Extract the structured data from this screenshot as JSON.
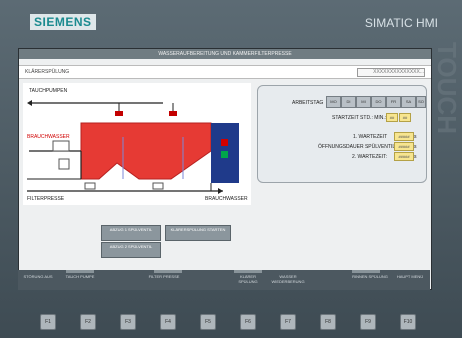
{
  "brand": "SIEMENS",
  "product": "SIMATIC HMI",
  "side_logo": "TOUCH",
  "screen": {
    "title": "WASSERAUFBEREITUNG UND KAMMERFILTERPRESSE",
    "left_status": "KLÄRERSPÜLUNG",
    "right_status": "XXXXXXXXXXXXXX..."
  },
  "diagram": {
    "tauchpumpen": "TAUCHPUMPEN",
    "brauchwasser_left": "BRAUCHWASSER",
    "filterpresse": "FILTERPRESSE",
    "brauchwasser_right": "BRAUCHWASSER"
  },
  "status_panel": {
    "arbeitstag": "ARBEITSTAG",
    "days": [
      "MO",
      "DI",
      "MI",
      "DO",
      "FR",
      "SA",
      "SO"
    ],
    "startzeit": "STARTZEIT STD.: MIN.:",
    "start_hour": "##",
    "start_min": "##",
    "wartezeit1_label": "1. WARTEZEIT",
    "wartezeit1_value": "#####",
    "oeffnungsdauer_label": "ÖFFNUNGSDAUER SPÜLVENTIL:",
    "oeffnungsdauer_value": "#####",
    "wartezeit2_label": "2. WARTEZEIT:",
    "wartezeit2_value": "#####",
    "unit": "s"
  },
  "buttons": {
    "abzug1": "ABZUG 1 SPÜLVENTIL",
    "abzug2": "ABZUG 2 SPÜLVENTIL",
    "klaerspuelung": "KLÄRERSPÜLUNG STARTEN"
  },
  "softkeys": [
    "STÖRUNG AUS",
    "TAUCH PUMPE",
    "",
    "FILTER PRESSE",
    "",
    "KLÄRER SPÜLUNG",
    "WASSER WIEDERBERUNG",
    "",
    "RINNEN SPÜLUNG",
    "HAUPT MENÜ"
  ],
  "function_keys": [
    "F1",
    "F2",
    "F3",
    "F4",
    "F5",
    "F6",
    "F7",
    "F8",
    "F9",
    "F10"
  ]
}
